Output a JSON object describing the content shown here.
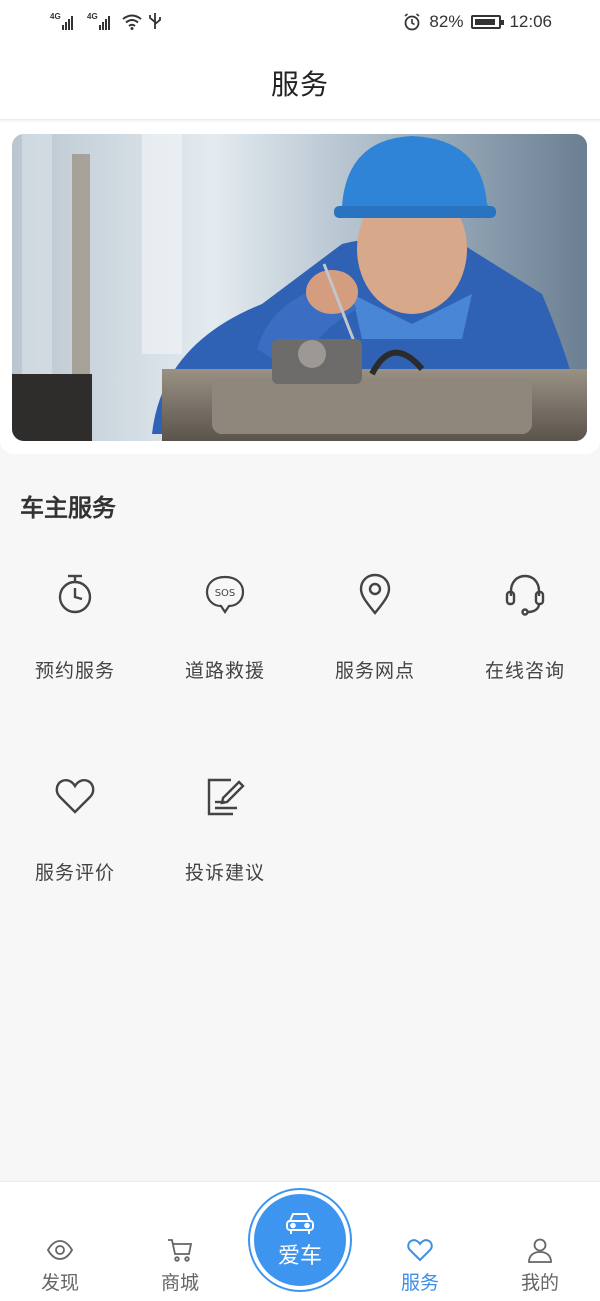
{
  "status_bar": {
    "network1": "4G",
    "network2": "4G",
    "battery_percent": "82%",
    "time": "12:06"
  },
  "header": {
    "title": "服务"
  },
  "banner": {
    "image_alt": "mechanic working on engine"
  },
  "section": {
    "title": "车主服务"
  },
  "services": [
    {
      "label": "预约服务",
      "icon": "timer-icon"
    },
    {
      "label": "道路救援",
      "icon": "sos-icon"
    },
    {
      "label": "服务网点",
      "icon": "location-pin-icon"
    },
    {
      "label": "在线咨询",
      "icon": "headset-icon"
    },
    {
      "label": "服务评价",
      "icon": "heart-icon"
    },
    {
      "label": "投诉建议",
      "icon": "edit-document-icon"
    }
  ],
  "tabs": [
    {
      "label": "发现",
      "icon": "eye-icon"
    },
    {
      "label": "商城",
      "icon": "cart-icon"
    },
    {
      "label": "爱车",
      "icon": "car-icon"
    },
    {
      "label": "服务",
      "icon": "heart-icon",
      "active": true
    },
    {
      "label": "我的",
      "icon": "user-icon"
    }
  ],
  "colors": {
    "accent": "#3d8ee6",
    "center_button": "#3d95f0"
  }
}
